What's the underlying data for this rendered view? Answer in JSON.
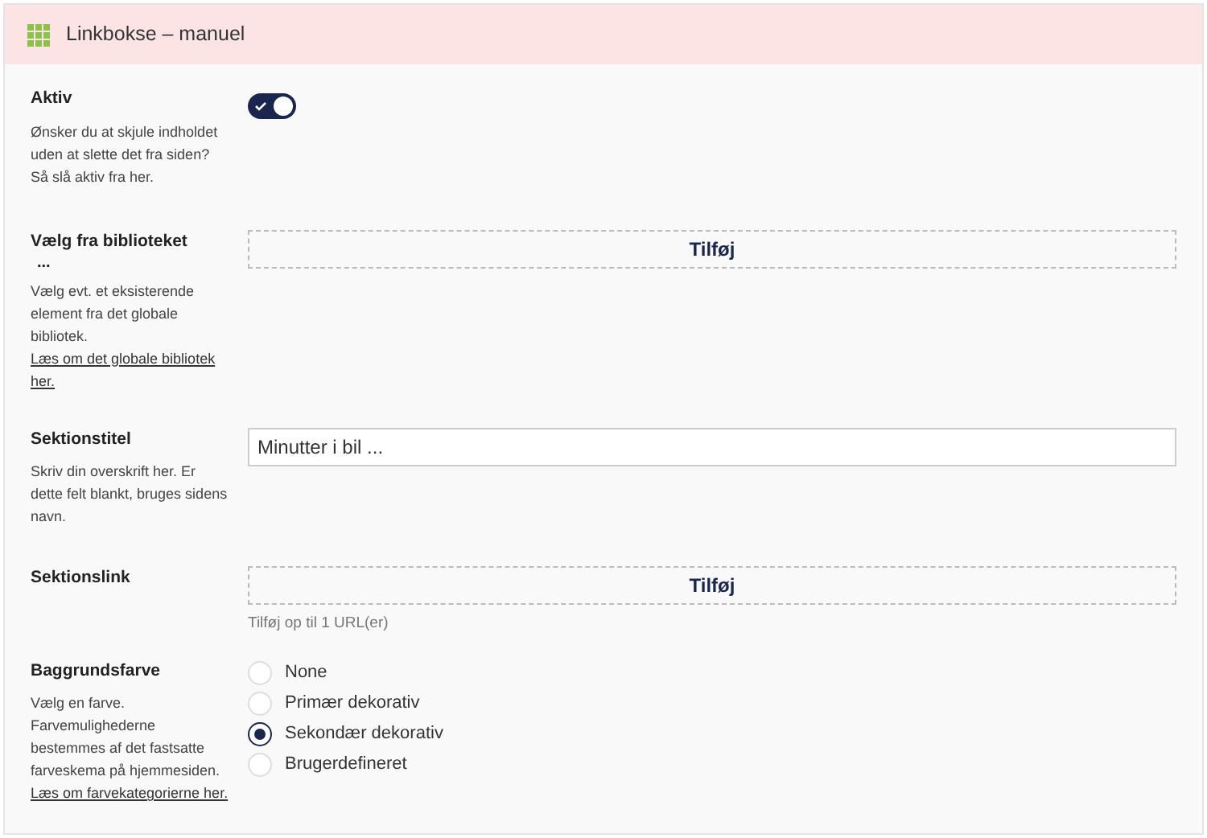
{
  "header": {
    "title": "Linkbokse – manuel"
  },
  "fields": [
    {
      "kind": "toggle",
      "label": "Aktiv",
      "description": "Ønsker du at skjule indholdet uden at slette det fra siden? Så slå aktiv fra her.",
      "on": true
    },
    {
      "kind": "add",
      "label": "Vælg fra biblioteket",
      "label_extra": "...",
      "description": "Vælg evt. et eksisterende element fra det globale bibliotek.",
      "link": "Læs om det globale bibliotek her.",
      "button": "Tilføj"
    },
    {
      "kind": "text",
      "label": "Sektionstitel",
      "description": "Skriv din overskrift her. Er dette felt blankt, bruges sidens navn.",
      "value": "Minutter i bil ..."
    },
    {
      "kind": "add",
      "label": "Sektionslink",
      "button": "Tilføj",
      "hint": "Tilføj op til 1 URL(er)"
    },
    {
      "kind": "radio",
      "label": "Baggrundsfarve",
      "description": "Vælg en farve. Farvemulighederne bestemmes af det fastsatte farveskema på hjemmesiden.",
      "link": "Læs om farvekategorierne her.",
      "options": [
        {
          "label": "None",
          "selected": false
        },
        {
          "label": "Primær dekorativ",
          "selected": false
        },
        {
          "label": "Sekondær dekorativ",
          "selected": true
        },
        {
          "label": "Brugerdefineret",
          "selected": false
        }
      ]
    }
  ]
}
